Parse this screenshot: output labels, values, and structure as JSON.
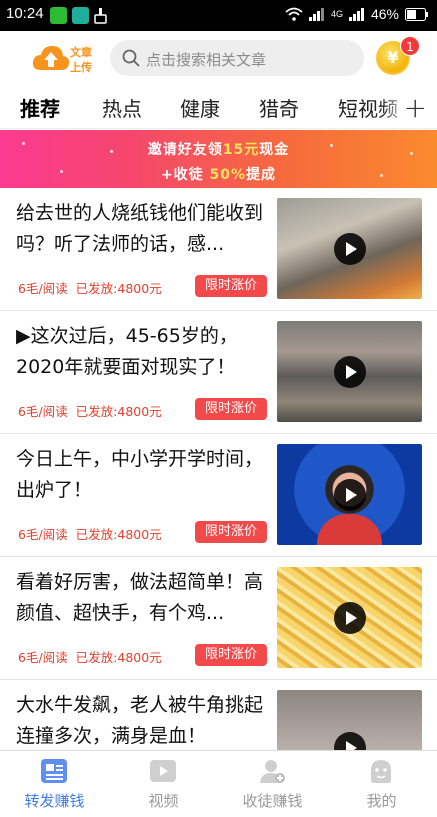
{
  "status_bar": {
    "time": "10:24",
    "battery": "46%",
    "network": "4G"
  },
  "header": {
    "logo_text_1": "文章",
    "logo_text_2": "上传",
    "search_placeholder": "点击搜索相关文章",
    "coin_badge": "1",
    "coin_glyph": "¥"
  },
  "tabs": [
    "推荐",
    "热点",
    "健康",
    "猎奇",
    "短视频"
  ],
  "banner": {
    "line1_a": "邀请好友领",
    "line1_hl": "15元",
    "line1_b": "现金",
    "line2_a": "+收徒 ",
    "line2_hl": "50%",
    "line2_b": "提成"
  },
  "articles": [
    {
      "title": "给去世的人烧纸钱他们能收到吗？听了法师的话，感...",
      "price": "6毛/阅读",
      "issued": "已发放:4800元",
      "promo": "限时涨价"
    },
    {
      "title": "▶这次过后，45-65岁的，2020年就要面对现实了！",
      "price": "6毛/阅读",
      "issued": "已发放:4800元",
      "promo": "限时涨价"
    },
    {
      "title": "今日上午，中小学开学时间，出炉了！",
      "price": "6毛/阅读",
      "issued": "已发放:4800元",
      "promo": "限时涨价"
    },
    {
      "title": "看着好厉害，做法超简单！高颜值、超快手，有个鸡...",
      "price": "6毛/阅读",
      "issued": "已发放:4800元",
      "promo": "限时涨价"
    },
    {
      "title": "大水牛发飙，老人被牛角挑起连撞多次，满身是血！",
      "price": "",
      "issued": "",
      "promo": ""
    }
  ],
  "bottom_nav": [
    {
      "label": "转发赚钱",
      "active": true
    },
    {
      "label": "视频",
      "active": false
    },
    {
      "label": "收徒赚钱",
      "active": false
    },
    {
      "label": "我的",
      "active": false
    }
  ],
  "colors": {
    "accent": "#3f7de9",
    "promo": "#f24a4a",
    "meta": "#e2412f",
    "logo": "#f7941d"
  }
}
